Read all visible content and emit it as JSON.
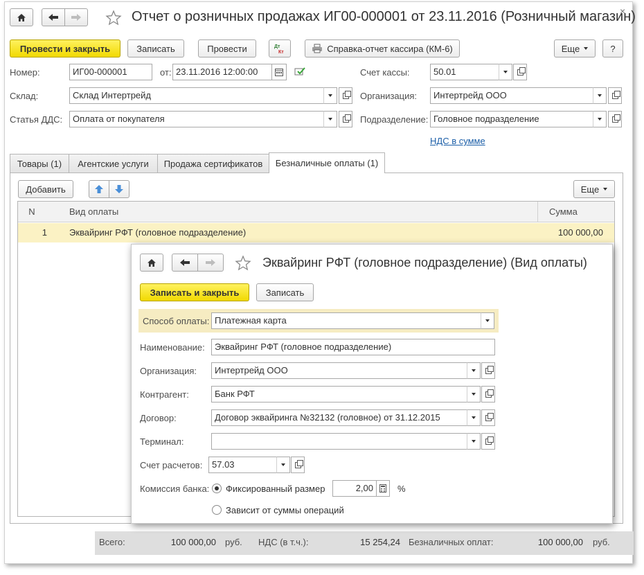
{
  "main": {
    "title": "Отчет о розничных продажах ИГ00-000001 от 23.11.2016 (Розничный магазин)",
    "toolbar": {
      "post_close": "Провести и закрыть",
      "save": "Записать",
      "post": "Провести",
      "report_km6": "Справка-отчет кассира (КМ-6)",
      "more": "Еще",
      "help": "?"
    },
    "fields": {
      "number_label": "Номер:",
      "number_value": "ИГ00-000001",
      "date_label": "от:",
      "date_value": "23.11.2016 12:00:00",
      "cash_account_label": "Счет кассы:",
      "cash_account_value": "50.01",
      "warehouse_label": "Склад:",
      "warehouse_value": "Склад Интертрейд",
      "org_label": "Организация:",
      "org_value": "Интертрейд ООО",
      "dds_label": "Статья ДДС:",
      "dds_value": "Оплата от покупателя",
      "division_label": "Подразделение:",
      "division_value": "Головное подразделение",
      "vat_link": "НДС в сумме"
    },
    "tabs": [
      {
        "label": "Товары (1)"
      },
      {
        "label": "Агентские услуги"
      },
      {
        "label": "Продажа сертификатов"
      },
      {
        "label": "Безналичные оплаты (1)"
      }
    ],
    "table_toolbar": {
      "add": "Добавить",
      "more": "Еще"
    },
    "table": {
      "headers": {
        "n": "N",
        "payment_type": "Вид оплаты",
        "sum": "Сумма"
      },
      "rows": [
        {
          "n": "1",
          "payment_type": "Эквайринг РФТ (головное подразделение)",
          "sum": "100 000,00"
        }
      ]
    },
    "footer": {
      "total_label": "Всего:",
      "total_value": "100 000,00",
      "total_cur": "руб.",
      "vat_label": "НДС (в т.ч.):",
      "vat_value": "15 254,24",
      "cashless_label": "Безналичных оплат:",
      "cashless_value": "100 000,00",
      "cashless_cur": "руб."
    }
  },
  "dialog": {
    "title": "Эквайринг РФТ (головное подразделение) (Вид оплаты)",
    "toolbar": {
      "save_close": "Записать и закрыть",
      "save": "Записать"
    },
    "fields": {
      "method_label": "Способ оплаты:",
      "method_value": "Платежная карта",
      "name_label": "Наименование:",
      "name_value": "Эквайринг РФТ (головное подразделение)",
      "org_label": "Организация:",
      "org_value": "Интертрейд ООО",
      "counterparty_label": "Контрагент:",
      "counterparty_value": "Банк РФТ",
      "contract_label": "Договор:",
      "contract_value": "Договор эквайринга №32132 (головное) от 31.12.2015",
      "terminal_label": "Терминал:",
      "terminal_value": "",
      "settle_account_label": "Счет расчетов:",
      "settle_account_value": "57.03",
      "commission_label": "Комиссия банка:",
      "fixed_label": "Фиксированный размер",
      "fixed_value": "2,00",
      "percent_sign": "%",
      "depends_label": "Зависит от суммы операций"
    }
  }
}
